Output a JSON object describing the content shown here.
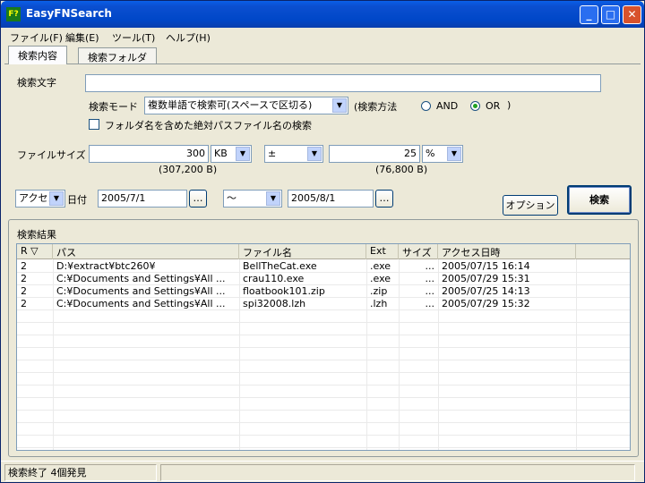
{
  "window": {
    "title": "EasyFNSearch",
    "icon_text": "F?",
    "minimize": "_",
    "maximize": "□",
    "close": "✕"
  },
  "menu": [
    "ファイル(F)",
    "編集(E)",
    "ツール(T)",
    "ヘルプ(H)"
  ],
  "tabs": [
    "検索内容",
    "検索フォルダ"
  ],
  "search": {
    "label": "検索文字",
    "value": "",
    "mode_label": "検索モード",
    "mode_value": "複数単語で検索可(スペースで区切る)",
    "method_label": "(検索方法",
    "and_label": "AND",
    "or_label": "OR",
    "close_paren": ")",
    "method_selected": "OR",
    "fullpath_label": "フォルダ名を含めた絶対パスファイル名の検索",
    "fullpath_checked": false
  },
  "filesize": {
    "label": "ファイルサイズ",
    "value": "300",
    "unit": "KB",
    "op": "±",
    "tol_value": "25",
    "tol_unit": "%",
    "bytes": "(307,200 B)",
    "tol_bytes": "(76,800 B)"
  },
  "date": {
    "type": "アクセス",
    "label": "日付",
    "from": "2005/7/1",
    "range": "～",
    "to": "2005/8/1",
    "browse": "…"
  },
  "buttons": {
    "options": "オプション",
    "search": "検索"
  },
  "results": {
    "label": "検索結果",
    "columns": [
      "R ▽",
      "パス",
      "ファイル名",
      "Ext",
      "サイズ",
      "アクセス日時"
    ],
    "rows": [
      [
        "2",
        "D:¥extract¥btc260¥",
        "BellTheCat.exe",
        ".exe",
        "...",
        "2005/07/15 16:14"
      ],
      [
        "2",
        "C:¥Documents and Settings¥All ...",
        "crau110.exe",
        ".exe",
        "...",
        "2005/07/29 15:31"
      ],
      [
        "2",
        "C:¥Documents and Settings¥All ...",
        "floatbook101.zip",
        ".zip",
        "...",
        "2005/07/25 14:13"
      ],
      [
        "2",
        "C:¥Documents and Settings¥All ...",
        "spi32008.lzh",
        ".lzh",
        "...",
        "2005/07/29 15:32"
      ]
    ]
  },
  "status": {
    "text": "検索終了 4個発見"
  }
}
